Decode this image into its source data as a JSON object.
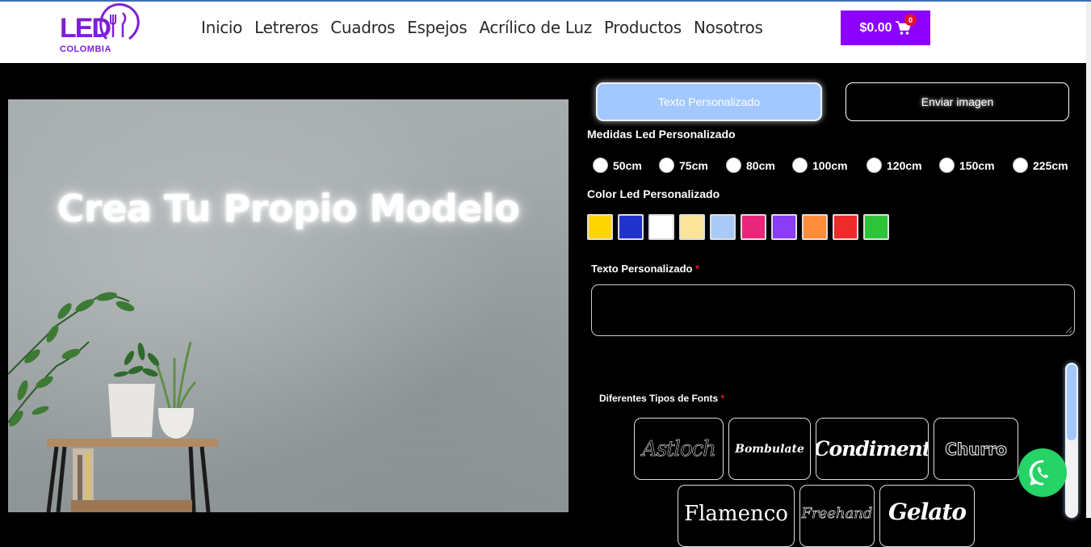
{
  "brand": {
    "logo_text": "LED",
    "logo_sub": "COLOMBIA",
    "accent": "#8b00ff"
  },
  "nav": [
    "Inicio",
    "Letreros",
    "Cuadros",
    "Espejos",
    "Acrílico de Luz",
    "Productos",
    "Nosotros"
  ],
  "cart": {
    "total": "$0.00",
    "count": "0"
  },
  "scene": {
    "title": "Crea Tu Propio Modelo"
  },
  "tabs": {
    "active": "Texto Personalizado",
    "inactive": "Enviar imagen"
  },
  "sizes": {
    "label": "Medidas Led Personalizado",
    "options": [
      "50cm",
      "75cm",
      "80cm",
      "100cm",
      "120cm",
      "150cm",
      "225cm"
    ]
  },
  "colors": {
    "label": "Color Led Personalizado",
    "swatches": [
      "#ffd500",
      "#2233cc",
      "#ffffff",
      "#fbe59a",
      "#a9c9f7",
      "#e8277b",
      "#8b3cf5",
      "#ff8c3a",
      "#ee2a2a",
      "#2ec43a"
    ]
  },
  "text_field": {
    "label": "Texto Personalizado",
    "required": "*",
    "value": ""
  },
  "fonts": {
    "label": "Diferentes Tipos de Fonts",
    "required": "*",
    "items": [
      "Astloch",
      "Bombulate",
      "Condiment",
      "Churro",
      "Flamenco",
      "Freehand",
      "Gelato"
    ]
  }
}
